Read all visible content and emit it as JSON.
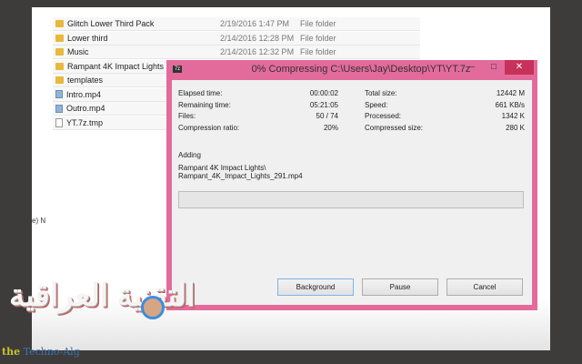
{
  "explorer": {
    "rows": [
      {
        "name": "Glitch Lower Third Pack",
        "date": "2/19/2016 1:47 PM",
        "type": "File folder",
        "icon": "folder-icon"
      },
      {
        "name": "Lower third",
        "date": "2/14/2016 12:28 PM",
        "type": "File folder",
        "icon": "folder-icon"
      },
      {
        "name": "Music",
        "date": "2/14/2016 12:32 PM",
        "type": "File folder",
        "icon": "folder-icon"
      },
      {
        "name": "Rampant 4K Impact Lights",
        "date": "",
        "type": "",
        "icon": "folder-icon"
      },
      {
        "name": "templates",
        "date": "",
        "type": "",
        "icon": "folder-icon"
      },
      {
        "name": "Intro.mp4",
        "date": "",
        "type": "",
        "icon": "video-file-icon"
      },
      {
        "name": "Outro.mp4",
        "date": "",
        "type": "",
        "icon": "video-file-icon"
      },
      {
        "name": "YT.7z.tmp",
        "date": "",
        "type": "",
        "icon": "file-icon"
      }
    ],
    "side_text": "e) N"
  },
  "dialog": {
    "title": "0% Compressing C:\\Users\\Jay\\Desktop\\YT\\YT.7z",
    "app_icon": "7z",
    "minimize": "–",
    "maximize": "□",
    "close": "✕",
    "left": [
      {
        "label": "Elapsed time:",
        "value": "00:00:02"
      },
      {
        "label": "Remaining time:",
        "value": "05:21:05"
      },
      {
        "label": "Files:",
        "value": "50 / 74"
      },
      {
        "label": "Compression ratio:",
        "value": "20%"
      }
    ],
    "right": [
      {
        "label": "Total size:",
        "value": "12442 M"
      },
      {
        "label": "Speed:",
        "value": "661 KB/s"
      },
      {
        "label": "Processed:",
        "value": "1342 K"
      },
      {
        "label": "Compressed size:",
        "value": "280 K"
      }
    ],
    "adding_label": "Adding",
    "path_line1": "Rampant 4K Impact Lights\\",
    "path_line2": "Rampant_4K_Impact_Lights_291.mp4",
    "progress": 0,
    "buttons": {
      "background": "Background",
      "pause": "Pause",
      "cancel": "Cancel"
    }
  },
  "watermark": {
    "arabic": "التقنية العراقية",
    "latin_a": "the",
    "latin_b": "Techno-Alg"
  }
}
